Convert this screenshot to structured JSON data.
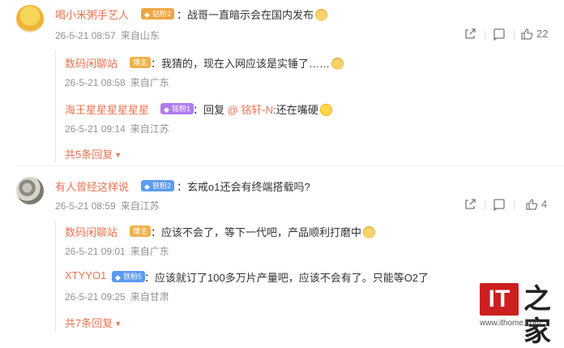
{
  "comments": [
    {
      "user": "喝小米粥手艺人",
      "badge": "钻粉2",
      "text": "：战哥一直暗示会在国内发布",
      "date": "26-5-21 08:57",
      "location": "来自山东",
      "likes": "22",
      "replies": [
        {
          "user": "数码闲聊站",
          "badge": "博主",
          "text": "：我猜的，现在入网应该是实锤了……",
          "date": "26-5-21 08:58",
          "location": "来自广东"
        },
        {
          "user": "海王星星星星星星",
          "badge": "铭粉1",
          "text_prefix": "：回复 ",
          "mention": "@ 铭轩-N",
          "text_suffix": ":还在嘴硬",
          "date": "26-5-21 09:14",
          "location": "来自江苏"
        }
      ],
      "more": "共5条回复"
    },
    {
      "user": "有人曾经这样说",
      "badge": "铁粉2",
      "text": "：玄戒o1还会有终端搭载吗?",
      "date": "26-5-21 08:59",
      "location": "来自江苏",
      "likes": "4",
      "replies": [
        {
          "user": "数码闲聊站",
          "badge": "博主",
          "text": "：应该不会了，等下一代吧，产品顺利打磨中",
          "date": "26-5-21 09:01",
          "location": "来自广东"
        },
        {
          "user": "XTYYO1",
          "badge": "铁粉5",
          "text": "：应该就订了100多万片产量吧，应该不会有了。只能等O2了",
          "date": "26-5-21 09:25",
          "location": "来自甘肃"
        }
      ],
      "more": "共7条回复"
    }
  ],
  "watermark": {
    "logo_text": "IT",
    "logo_cn": "之家",
    "url": "www.ithome.com"
  },
  "colors": {
    "accent": "#eb7350",
    "meta": "#939393",
    "logo_red": "#cc1f1f"
  }
}
